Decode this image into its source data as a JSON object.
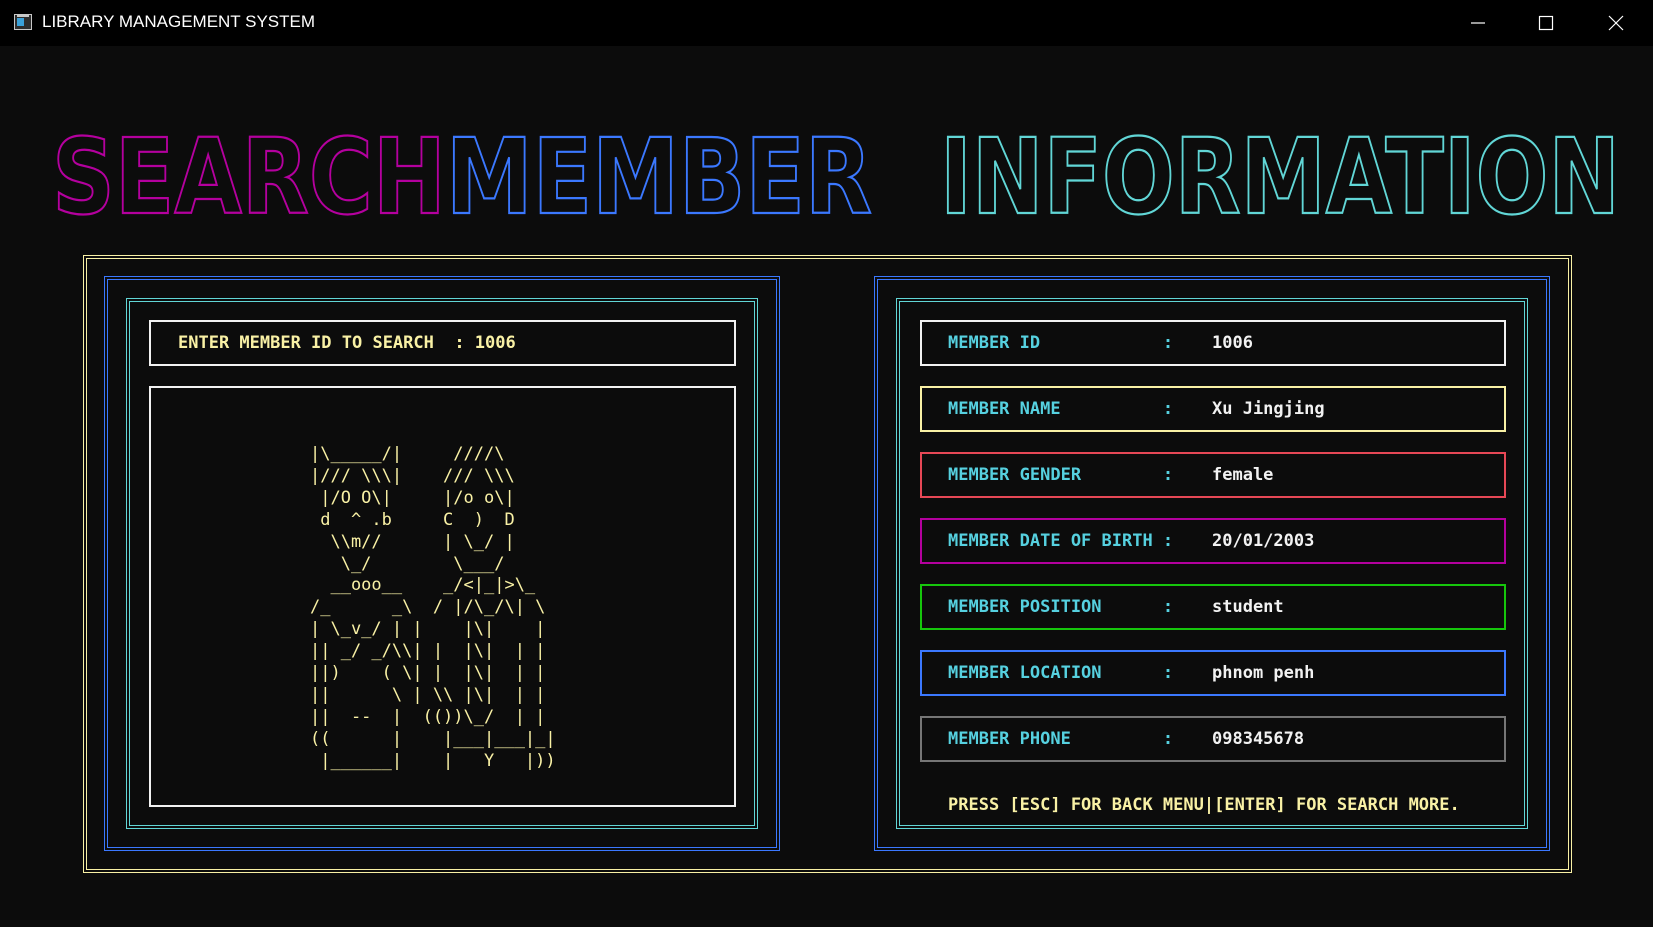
{
  "window": {
    "title": "LIBRARY MANAGEMENT SYSTEM",
    "minimize_icon": "minimize-icon",
    "maximize_icon": "maximize-icon",
    "close_icon": "close-icon"
  },
  "banner": {
    "word1": "SEARCH",
    "word2": "MEMBER",
    "word3": "INFORMATION",
    "colors": {
      "word1": "#b4009e",
      "word2": "#3b78ff",
      "word3": "#61d6d6",
      "alt": "#b4009e"
    }
  },
  "search": {
    "prompt": "ENTER MEMBER ID TO SEARCH  : 1006"
  },
  "art": {
    "lines": [
      "|\\_____/|     ////\\",
      "|/// \\\\\\|    /// \\\\\\",
      " |/O O\\|     |/o o\\|",
      " d  ^ .b     C  )  D",
      "  \\\\m//      | \\_/ |",
      "   \\_/        \\___/",
      "  __ooo__    _/<|_|>\\_",
      "/_      _\\  / |/\\_/\\| \\",
      "| \\_v_/ | |    |\\|    |",
      "|| _/ _/\\\\| |  |\\|  | |",
      "||)    ( \\| |  |\\|  | |",
      "||      \\ | \\\\ |\\|  | |",
      "||  --  |  (())\\_/  | |",
      "((      |    |___|___|_|",
      " |______|    |   Y   |))"
    ]
  },
  "member": {
    "fields": [
      {
        "label": "MEMBER ID            :",
        "value": "1006",
        "border": "#f2f2f2"
      },
      {
        "label": "MEMBER NAME          :",
        "value": "Xu Jingjing",
        "border": "#f9f1a5"
      },
      {
        "label": "MEMBER GENDER        :",
        "value": "female",
        "border": "#e74856"
      },
      {
        "label": "MEMBER DATE OF BIRTH :",
        "value": "20/01/2003",
        "border": "#b4009e"
      },
      {
        "label": "MEMBER POSITION      :",
        "value": "student",
        "border": "#16c60c"
      },
      {
        "label": "MEMBER LOCATION      :",
        "value": "phnom penh",
        "border": "#3b78ff"
      },
      {
        "label": "MEMBER PHONE         :",
        "value": "098345678",
        "border": "#767676"
      }
    ],
    "hint": "PRESS [ESC] FOR BACK MENU|[ENTER] FOR SEARCH MORE."
  },
  "colors": {
    "outer_frame": "#f9f1a5",
    "blue_frame": "#3b78ff",
    "cyan_frame": "#61d6d6",
    "white_frame": "#f2f2f2"
  }
}
